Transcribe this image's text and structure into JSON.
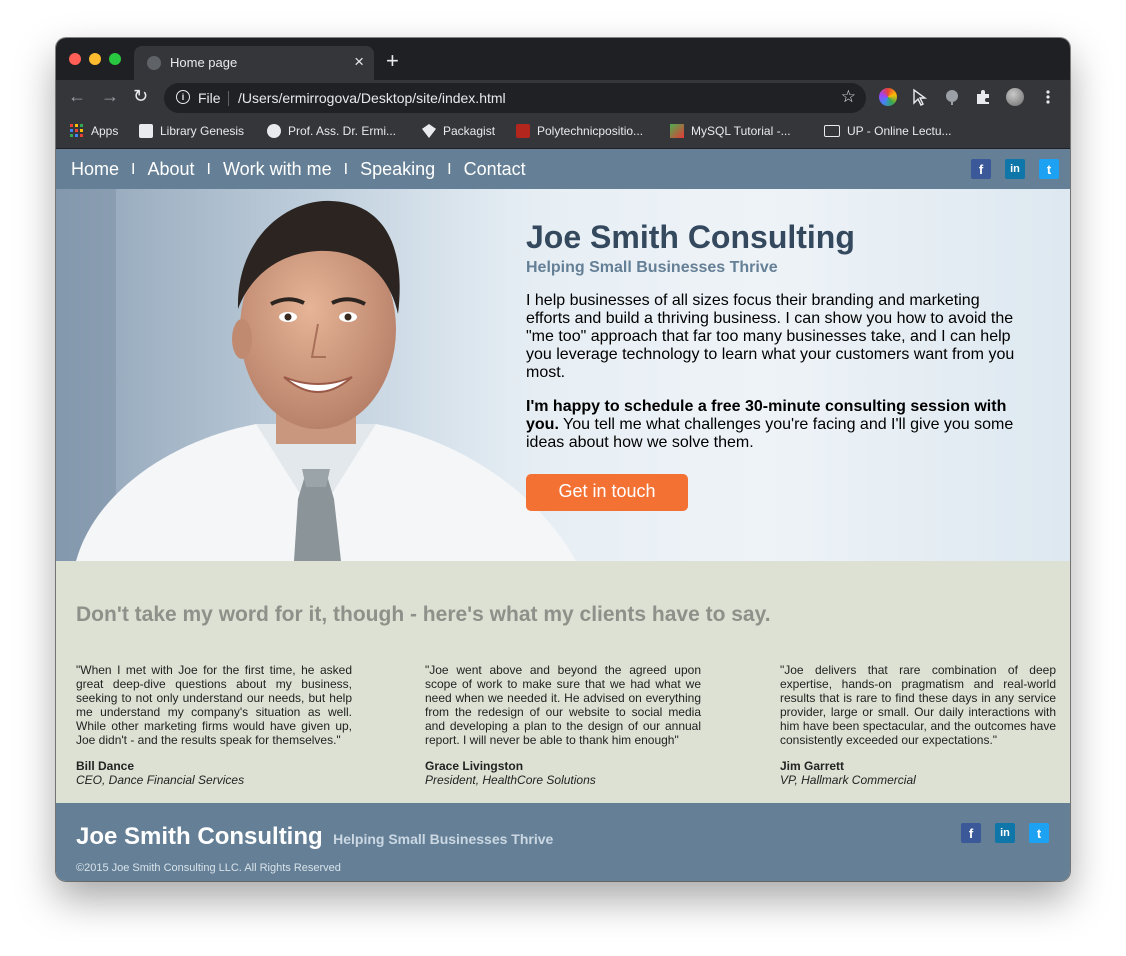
{
  "browser": {
    "tab_title": "Home page",
    "omnibox_scheme": "File",
    "omnibox_url": "/Users/ermirrogova/Desktop/site/index.html",
    "bookmarks": [
      "Apps",
      "Library Genesis",
      "Prof. Ass. Dr. Ermi...",
      "Packagist",
      "Polytechnicpositio...",
      "MySQL Tutorial -...",
      "UP - Online Lectu..."
    ]
  },
  "site": {
    "nav": [
      "Home",
      "About",
      "Work with me",
      "Speaking",
      "Contact"
    ],
    "nav_separator": "I",
    "social": {
      "fb": "f",
      "li": "in",
      "tw": "t"
    },
    "hero": {
      "title": "Joe Smith Consulting",
      "subtitle": "Helping Small Businesses Thrive",
      "paragraph1": "I help businesses of all sizes focus their branding and marketing efforts and build a thriving business. I can show you how to avoid the \"me too\" approach that far too many businesses take, and I can help you leverage technology to learn what your customers want from you most.",
      "paragraph2_bold": "I'm happy to schedule a free 30-minute consulting session with you.",
      "paragraph2_rest": " You tell me what challenges you're facing and I'll give you some ideas about how we solve them.",
      "cta": "Get in touch"
    },
    "testimonials": {
      "heading": "Don't take my word for it, though - here's what my clients have to say.",
      "items": [
        {
          "quote": "\"When I met with Joe for the first time, he asked great deep-dive questions about my business, seeking to not only understand our needs, but help me understand my company's situation as well. While other marketing firms would have given up, Joe didn't - and the results speak for themselves.\"",
          "name": "Bill Dance",
          "title": "CEO, Dance Financial Services"
        },
        {
          "quote": "\"Joe went above and beyond the agreed upon scope of work to make sure that we had what we need when we needed it. He advised on everything from the redesign of our website to social media and developing a plan to the design of our annual report. I will never be able to thank him enough\"",
          "name": "Grace Livingston",
          "title": "President, HealthCore Solutions"
        },
        {
          "quote": "\"Joe delivers that rare combination of deep expertise, hands-on pragmatism and real-world results that is rare to find these days in any service provider, large or small. Our daily interactions with him have been spectacular, and the outcomes have consistently exceeded our expectations.\"",
          "name": "Jim Garrett",
          "title": "VP, Hallmark Commercial"
        }
      ]
    },
    "footer": {
      "name": "Joe Smith Consulting",
      "tagline": "Helping Small Businesses Thrive",
      "copyright": "©2015 Joe Smith Consulting LLC. All Rights Reserved"
    }
  },
  "colors": {
    "nav_bg": "#658096",
    "title": "#34495e",
    "cta": "#f47134",
    "testimonials_bg": "#dde1d3"
  }
}
